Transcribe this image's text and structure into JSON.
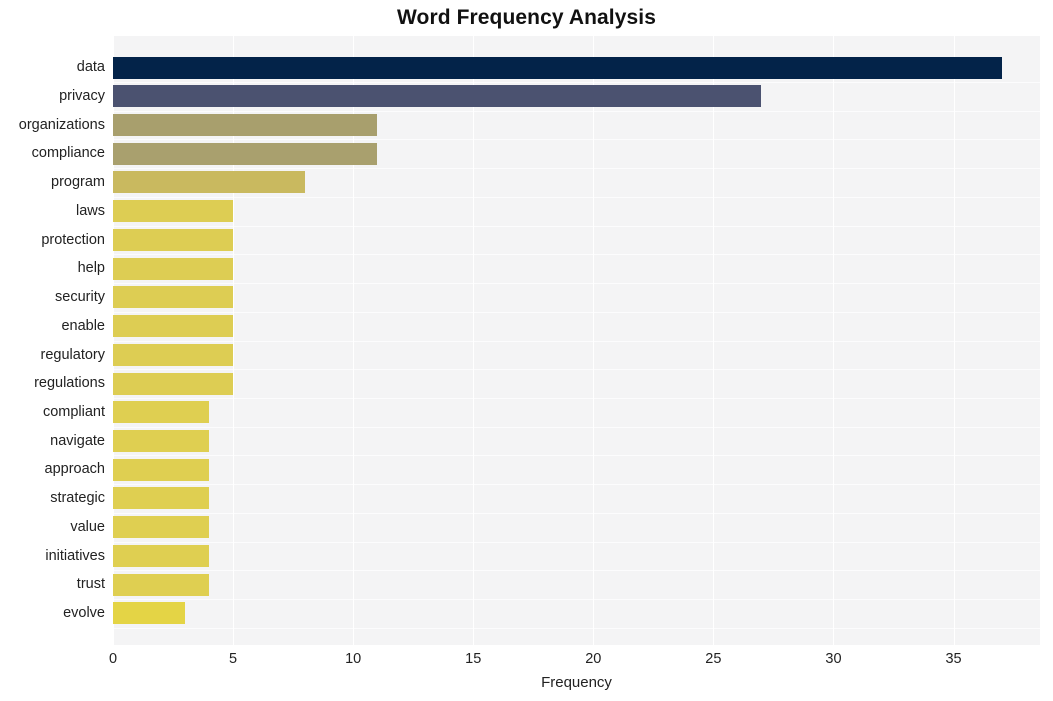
{
  "chart_data": {
    "type": "bar",
    "orientation": "horizontal",
    "title": "Word Frequency Analysis",
    "xlabel": "Frequency",
    "ylabel": "",
    "xlim": [
      0,
      38.6
    ],
    "xticks": [
      0,
      5,
      10,
      15,
      20,
      25,
      30,
      35
    ],
    "grid": true,
    "grid_axis": "both",
    "legend": "none",
    "categories": [
      "data",
      "privacy",
      "organizations",
      "compliance",
      "program",
      "laws",
      "protection",
      "help",
      "security",
      "enable",
      "regulatory",
      "regulations",
      "compliant",
      "navigate",
      "approach",
      "strategic",
      "value",
      "initiatives",
      "trust",
      "evolve"
    ],
    "values": [
      37,
      27,
      11,
      11,
      8,
      5,
      5,
      5,
      5,
      5,
      5,
      5,
      4,
      4,
      4,
      4,
      4,
      4,
      4,
      3
    ],
    "colors": [
      "#032349",
      "#4b5270",
      "#a89f6d",
      "#a9a06e",
      "#c9b95f",
      "#ddcd53",
      "#ddcd53",
      "#ddcd53",
      "#ddcd53",
      "#ddcd53",
      "#ddcd53",
      "#ddcd53",
      "#dfcf51",
      "#dfcf51",
      "#dfcf51",
      "#dfcf51",
      "#dfcf51",
      "#dfcf51",
      "#dfcf51",
      "#e4d445"
    ]
  },
  "figure": {
    "plot_background": "#f4f4f5",
    "page_background": "#ffffff",
    "grid_color": "#ffffff",
    "text_color": "#222222"
  }
}
